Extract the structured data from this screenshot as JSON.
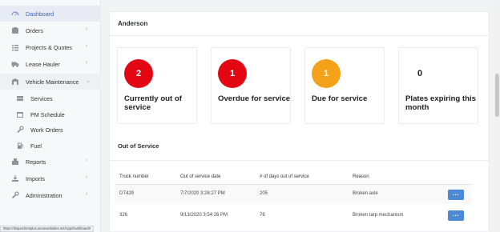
{
  "sidebar": {
    "items": [
      {
        "label": "Dashboard",
        "icon": "dashboard-icon",
        "chevron": ""
      },
      {
        "label": "Orders",
        "icon": "orders-icon",
        "chevron": "›"
      },
      {
        "label": "Projects & Quotes",
        "icon": "projects-icon",
        "chevron": "›"
      },
      {
        "label": "Lease Hauler",
        "icon": "truck-icon",
        "chevron": "›"
      },
      {
        "label": "Vehicle Maintenance",
        "icon": "vehicle-icon",
        "chevron": "⌄"
      },
      {
        "label": "Services",
        "icon": "services-icon",
        "chevron": ""
      },
      {
        "label": "PM Schedule",
        "icon": "calendar-icon",
        "chevron": ""
      },
      {
        "label": "Work Orders",
        "icon": "wrench-icon",
        "chevron": ""
      },
      {
        "label": "Fuel",
        "icon": "fuel-icon",
        "chevron": ""
      },
      {
        "label": "Reports",
        "icon": "reports-icon",
        "chevron": "›"
      },
      {
        "label": "Imports",
        "icon": "imports-icon",
        "chevron": "›"
      },
      {
        "label": "Administration",
        "icon": "wrench-icon",
        "chevron": "›"
      }
    ]
  },
  "card": {
    "title": "Anderson"
  },
  "tiles": [
    {
      "value": "2",
      "label": "Currently out of service",
      "color": "#e30613"
    },
    {
      "value": "1",
      "label": "Overdue for service",
      "color": "#e30613"
    },
    {
      "value": "1",
      "label": "Due for service",
      "color": "#f5a21b"
    },
    {
      "value": "0",
      "label": "Plates expiring this month",
      "color": ""
    }
  ],
  "out_of_service": {
    "title": "Out of Service",
    "columns": [
      "Truck number",
      "Out of service date",
      "# of days out of service",
      "Reason"
    ],
    "rows": [
      {
        "truck": "DT429",
        "date": "7/7/2020 3:28:27 PM",
        "days": "205",
        "reason": "Broken axle",
        "action": "···"
      },
      {
        "truck": "326",
        "date": "9/13/2020 3:54:26 PM",
        "days": "76",
        "reason": "Broken tarp mechanism",
        "action": "···"
      }
    ]
  },
  "status_url": "https://dispatchersplus.azurewebsites.net/App/Dashboard#"
}
